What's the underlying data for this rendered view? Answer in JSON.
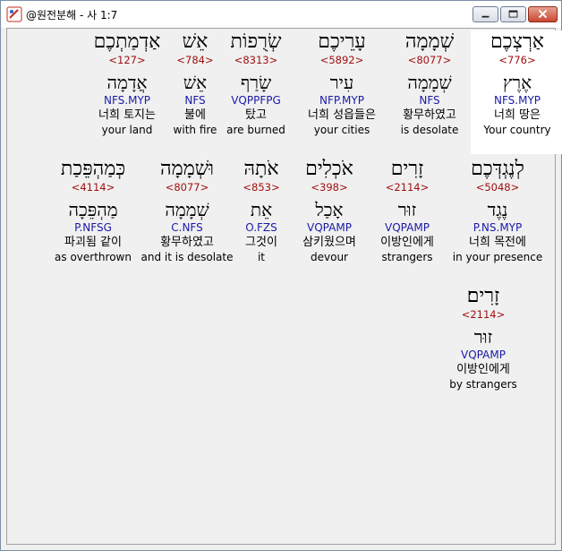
{
  "window": {
    "title": "@원전분해 - 사 1:7"
  },
  "rows": [
    [
      {
        "heb": "אַרְצְכֶם",
        "strong": "<776>",
        "lemma": "אֶרֶץ",
        "parse": "NFS.MYP",
        "kor": "너희 땅은",
        "eng": "Your country",
        "selected": true
      },
      {
        "heb": "שְׁמָמָה",
        "strong": "<8077>",
        "lemma": "שְׁמָמָה",
        "parse": "NFS",
        "kor": "황무하였고",
        "eng": "is desolate"
      },
      {
        "heb": "עָרֵיכֶם",
        "strong": "<5892>",
        "lemma": "עִיר",
        "parse": "NFP.MYP",
        "kor": "너희 성읍들은",
        "eng": "your cities"
      },
      {
        "heb": "שְׂרֻפוֹת",
        "strong": "<8313>",
        "lemma": "שָׂרַף",
        "parse": "VQPPFPG",
        "kor": "탔고",
        "eng": "are burned"
      },
      {
        "heb": "אֵשׁ",
        "strong": "<784>",
        "lemma": "אֵשׁ",
        "parse": "NFS",
        "kor": "불에",
        "eng": "with fire"
      },
      {
        "heb": "אַדְמַתְכֶם",
        "strong": "<127>",
        "lemma": "אֲדָמָה",
        "parse": "NFS.MYP",
        "kor": "너희 토지는",
        "eng": "your land"
      }
    ],
    [
      {
        "heb": "לְנֶגְדְּכֶם",
        "strong": "<5048>",
        "lemma": "נֶגֶד",
        "parse": "P.NS.MYP",
        "kor": "너희 목전에",
        "eng": "in your presence"
      },
      {
        "heb": "זָרִים",
        "strong": "<2114>",
        "lemma": "זוּר",
        "parse": "VQPAMP",
        "kor": "이방인에게",
        "eng": "strangers"
      },
      {
        "heb": "אֹכְלִים",
        "strong": "<398>",
        "lemma": "אָכַל",
        "parse": "VQPAMP",
        "kor": "삼키웠으며",
        "eng": "devour"
      },
      {
        "heb": "אֹתָהּ",
        "strong": "<853>",
        "lemma": "אֵת",
        "parse": "O.FZS",
        "kor": "그것이",
        "eng": "it"
      },
      {
        "heb": "וּשְׁמָמָה",
        "strong": "<8077>",
        "lemma": "שְׁמָמָה",
        "parse": "C.NFS",
        "kor": "황무하였고",
        "eng": "and it is desolate"
      },
      {
        "heb": "כְּמַהְפֵּכַת",
        "strong": "<4114>",
        "lemma": "מַהְפֵּכָה",
        "parse": "P.NFSG",
        "kor": "파괴됨 같이",
        "eng": "as overthrown"
      }
    ],
    [
      {
        "heb": "זָרִים׃",
        "strong": "<2114>",
        "lemma": "זוּר",
        "parse": "VQPAMP",
        "kor": "이방인에게",
        "eng": "by strangers"
      }
    ]
  ]
}
